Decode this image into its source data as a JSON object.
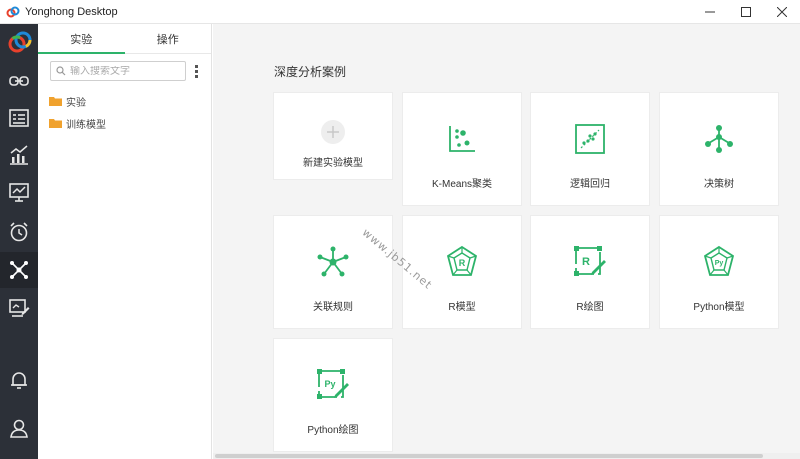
{
  "window": {
    "title": "Yonghong Desktop",
    "controls": [
      "minimize-icon",
      "maximize-icon",
      "close-icon"
    ]
  },
  "rail": {
    "items": [
      {
        "name": "link-icon"
      },
      {
        "name": "list-icon"
      },
      {
        "name": "bar-chart-icon"
      },
      {
        "name": "presentation-icon"
      },
      {
        "name": "alarm-icon"
      },
      {
        "name": "network-icon",
        "active": true
      },
      {
        "name": "screen-edit-icon"
      },
      {
        "name": "bell-icon"
      },
      {
        "name": "user-icon"
      }
    ]
  },
  "panel": {
    "tabs": [
      {
        "label": "实验",
        "active": true
      },
      {
        "label": "操作",
        "active": false
      }
    ],
    "search": {
      "placeholder": "输入搜索文字",
      "value": ""
    },
    "tree": [
      {
        "label": "实验"
      },
      {
        "label": "训练模型"
      }
    ]
  },
  "main": {
    "section_title": "深度分析案例",
    "cards": [
      {
        "label": "新建实验模型",
        "icon": "plus-icon"
      },
      {
        "label": "K-Means聚类",
        "icon": "scatter-icon"
      },
      {
        "label": "逻辑回归",
        "icon": "regression-icon"
      },
      {
        "label": "决策树",
        "icon": "tree-icon"
      },
      {
        "label": "关联规则",
        "icon": "asterisk-network-icon"
      },
      {
        "label": "R模型",
        "icon": "r-model-icon"
      },
      {
        "label": "R绘图",
        "icon": "r-plot-icon"
      },
      {
        "label": "Python模型",
        "icon": "python-model-icon"
      },
      {
        "label": "Python绘图",
        "icon": "python-plot-icon"
      }
    ],
    "watermark": "www.jb51.net"
  },
  "colors": {
    "accent": "#2db36a",
    "rail_bg": "#2c3038",
    "main_bg": "#f4f4f4",
    "folder": "#f0a22e"
  }
}
